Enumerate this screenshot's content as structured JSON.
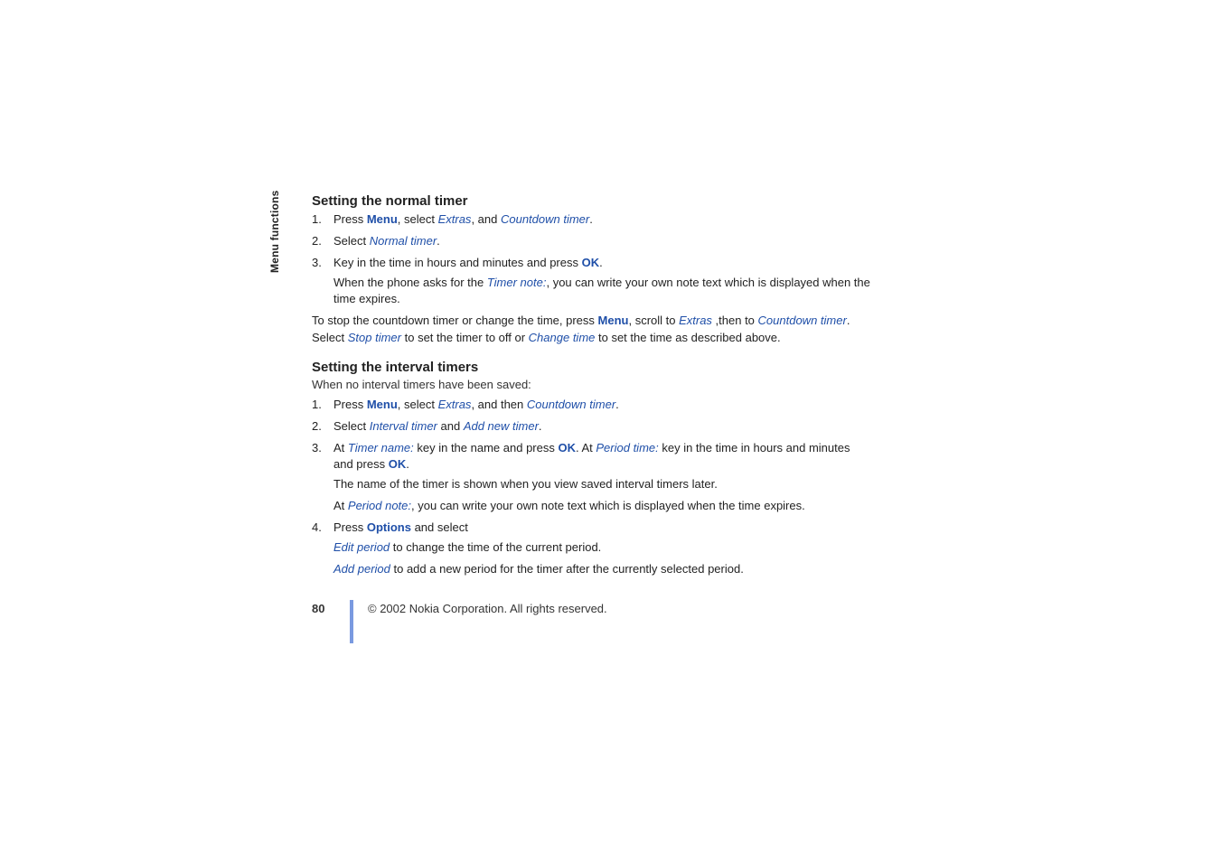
{
  "sidebar": {
    "label": "Menu functions"
  },
  "section1": {
    "title": "Setting the normal timer",
    "steps": {
      "s1": {
        "press": "Press ",
        "menu": "Menu",
        "sel": ", select ",
        "extras": "Extras",
        "and": ", and ",
        "timer": "Countdown timer",
        "dot": "."
      },
      "s2": {
        "select": "Select ",
        "normal": "Normal timer",
        "dot": "."
      },
      "s3": {
        "keyin": "Key in the time in hours and minutes and press ",
        "ok": "OK",
        "dot": "."
      }
    },
    "note": {
      "a": "When the phone asks for the ",
      "timernote": "Timer note:",
      "b": ", you can write your own note text which is displayed when the time expires."
    },
    "para2": {
      "a": "To stop the countdown timer or change the time, press ",
      "menu": "Menu",
      "b": ", scroll to ",
      "extras": "Extras",
      "c": " ,then to ",
      "timer": "Countdown timer",
      "d": ". Select ",
      "stop": "Stop timer",
      "e": " to set the timer to off or ",
      "change": "Change time",
      "f": " to set the time as described above."
    }
  },
  "section2": {
    "title": "Setting the interval timers",
    "sub": "When no interval timers have been saved:",
    "steps": {
      "s1": {
        "press": "Press ",
        "menu": "Menu",
        "sel": ", select ",
        "extras": "Extras",
        "and": ", and then ",
        "timer": "Countdown timer",
        "dot": "."
      },
      "s2": {
        "select": "Select ",
        "interval": "Interval timer",
        "and": " and ",
        "addnew": "Add new timer",
        "dot": "."
      },
      "s3": {
        "a": "At ",
        "tname": "Timer name:",
        "b": " key in the name and press ",
        "ok1": "OK",
        "c": ". At ",
        "ptime": "Period time:",
        "d": " key in the time in hours and minutes and press ",
        "ok2": "OK",
        "dot": "."
      },
      "s4": {
        "press": "Press ",
        "options": "Options",
        "and": " and select"
      }
    },
    "ind1": "The name of the timer is shown when you view saved interval timers later.",
    "ind2": {
      "a": "At ",
      "pnote": "Period note:",
      "b": ", you can write your own note text which is displayed when the time expires."
    },
    "ind3": {
      "edit": "Edit period",
      "t": " to change the time of the current period."
    },
    "ind4": {
      "add": "Add period",
      "t": " to add a new period for the timer after the currently selected period."
    }
  },
  "footer": {
    "page": "80",
    "copyright": "© 2002 Nokia Corporation. All rights reserved."
  }
}
